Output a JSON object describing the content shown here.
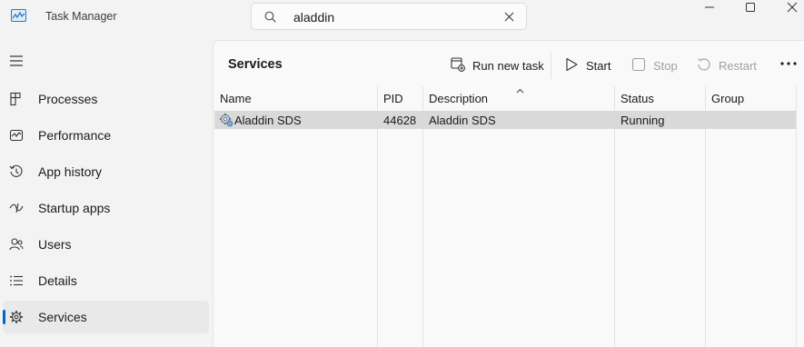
{
  "app": {
    "title": "Task Manager"
  },
  "search": {
    "value": "aladdin"
  },
  "sidebar": {
    "items": [
      {
        "label": "Processes",
        "icon": "processes-icon"
      },
      {
        "label": "Performance",
        "icon": "performance-icon"
      },
      {
        "label": "App history",
        "icon": "app-history-icon"
      },
      {
        "label": "Startup apps",
        "icon": "startup-apps-icon"
      },
      {
        "label": "Users",
        "icon": "users-icon"
      },
      {
        "label": "Details",
        "icon": "details-icon"
      },
      {
        "label": "Services",
        "icon": "services-icon",
        "active": true
      }
    ]
  },
  "page": {
    "title": "Services"
  },
  "toolbar": {
    "run_new_task": "Run new task",
    "start": "Start",
    "stop": "Stop",
    "restart": "Restart"
  },
  "table": {
    "columns": [
      "Name",
      "PID",
      "Description",
      "Status",
      "Group"
    ],
    "sorted_column": "Description",
    "rows": [
      {
        "name": "Aladdin SDS",
        "pid": "44628",
        "description": "Aladdin SDS",
        "status": "Running",
        "group": "",
        "selected": true
      }
    ]
  },
  "colors": {
    "accent": "#0067c0",
    "selected_row": "#d9d9d9"
  }
}
